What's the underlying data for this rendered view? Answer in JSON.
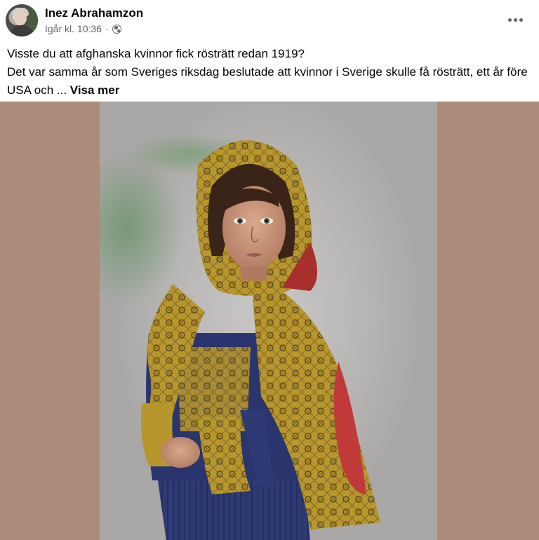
{
  "post": {
    "author_name": "Inez Abrahamzon",
    "timestamp": "Igår kl. 10:36",
    "separator": "·",
    "audience_icon": "globe-icon",
    "more_icon": "more-horizontal-icon",
    "text_line1": "Visste du att afghanska kvinnor fick rösträtt redan 1919?",
    "text_line2": "Det var samma år som Sveriges riksdag beslutade att kvinnor i Sverige skulle få rösträtt, ett år före USA och ...",
    "see_more_label": "Visa mer"
  },
  "colors": {
    "photo_background": "#ad8b7b",
    "secondary_text": "#65676b"
  }
}
